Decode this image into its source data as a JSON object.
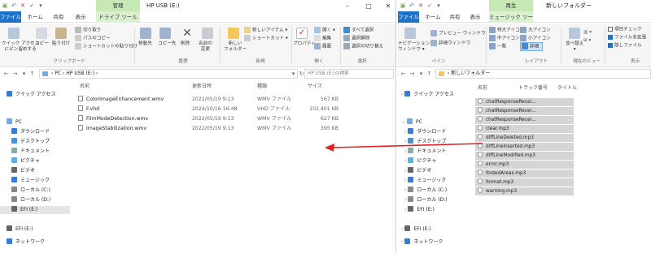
{
  "left_window": {
    "title": "HP USB (E:)",
    "context_tab_header": "管理",
    "tabs": [
      "ファイル",
      "ホーム",
      "共有",
      "表示",
      "ドライブ ツール"
    ],
    "ribbon": {
      "pin_label": "クイック アクセス\nにピン留めする",
      "copy_label": "コピー",
      "paste_label": "貼り付け",
      "cut_label": "切り取り",
      "copy_path_label": "パスのコピー",
      "paste_shortcut_label": "ショートカットの貼り付け",
      "move_to_label": "移動先",
      "copy_to_label": "コピー先",
      "delete_label": "削除",
      "rename_label": "名前の\n変更",
      "new_folder_label": "新しい\nフォルダー",
      "new_item_label": "新しいアイテム ▾",
      "shortcut_label": "ショートカット ▾",
      "properties_label": "プロパティ",
      "open_label": "開く ▾",
      "edit_label": "編集",
      "history_label": "履歴",
      "select_all_label": "すべて選択",
      "select_none_label": "選択解除",
      "invert_select_label": "選択の切り替え",
      "groups": [
        "クリップボード",
        "整理",
        "新規",
        "開く",
        "選択"
      ]
    },
    "address": {
      "path": [
        "PC",
        "HP USB (E:)"
      ],
      "search_placeholder": "HP USB (E:)の検索"
    },
    "columns": [
      "名前",
      "更新日時",
      "種類",
      "サイズ"
    ],
    "files": [
      {
        "name": "ColorImageEnhancement.wmv",
        "date": "2022/05/19 9:13",
        "type": "WMV ファイル",
        "size": "567 KB"
      },
      {
        "name": "F.vhd",
        "date": "2024/10/16 16:48",
        "type": "VHD ファイル",
        "size": "102,401 KB"
      },
      {
        "name": "FilmModeDetection.wmv",
        "date": "2022/05/19 9:13",
        "type": "WMV ファイル",
        "size": "627 KB"
      },
      {
        "name": "ImageStabilization.wmv",
        "date": "2022/05/19 9:13",
        "type": "WMV ファイル",
        "size": "395 KB"
      }
    ],
    "nav": [
      "クイック アクセス",
      "PC",
      "ダウンロード",
      "デスクトップ",
      "ドキュメント",
      "ピクチャ",
      "ビデオ",
      "ミュージック",
      "ローカル (C:)",
      "ローカル (D:)",
      "EFI (E:)",
      "EFI (E:)",
      "ネットワーク"
    ]
  },
  "right_window": {
    "title": "新しいフォルダー",
    "context_tab_header": "再生",
    "tabs": [
      "ファイル",
      "ホーム",
      "共有",
      "表示",
      "ミュージック ツール"
    ],
    "ribbon": {
      "nav_pane_label": "ナビゲーション\nウィンドウ ▾",
      "preview_pane_label": "プレビュー ウィンドウ",
      "details_pane_label": "詳細ウィンドウ",
      "extra_large_label": "特大アイコン",
      "large_label": "大アイコン",
      "medium_label": "中アイコン",
      "small_label": "小アイコン",
      "list_label": "一覧",
      "details_label": "詳細",
      "sort_label": "並べ替え\n▾",
      "item_checkbox_label": "項目チェック",
      "extension_label": "ファイル名拡張",
      "hidden_label": "隠しファイル",
      "groups": [
        "ペイン",
        "レイアウト",
        "現在のビュー",
        "表示"
      ]
    },
    "address": {
      "path": [
        "新しいフォルダー"
      ]
    },
    "columns": [
      "名前",
      "トラック番号",
      "タイトル"
    ],
    "files": [
      "chatResponseRecei...",
      "chatResponseRecei...",
      "chatResponseRecei...",
      "clear.mp3",
      "diffLineDeleted.mp3",
      "diffLineInserted.mp3",
      "diffLineModified.mp3",
      "error.mp3",
      "foldedAreas.mp3",
      "format.mp3",
      "warning.mp3"
    ],
    "nav": [
      "クイック アクセス",
      "PC",
      "ダウンロード",
      "デスクトップ",
      "ドキュメント",
      "ピクチャ",
      "ビデオ",
      "ミュージック",
      "ローカル (C:)",
      "ローカル (D:)",
      "EFI (E:)",
      "EFI (E:)",
      "ネットワーク"
    ]
  },
  "colors": {
    "file_tab": "#1a73c9",
    "context_tab": "#c5e8b5",
    "selection": "#d5d5d5",
    "arrow": "#e0221e"
  }
}
